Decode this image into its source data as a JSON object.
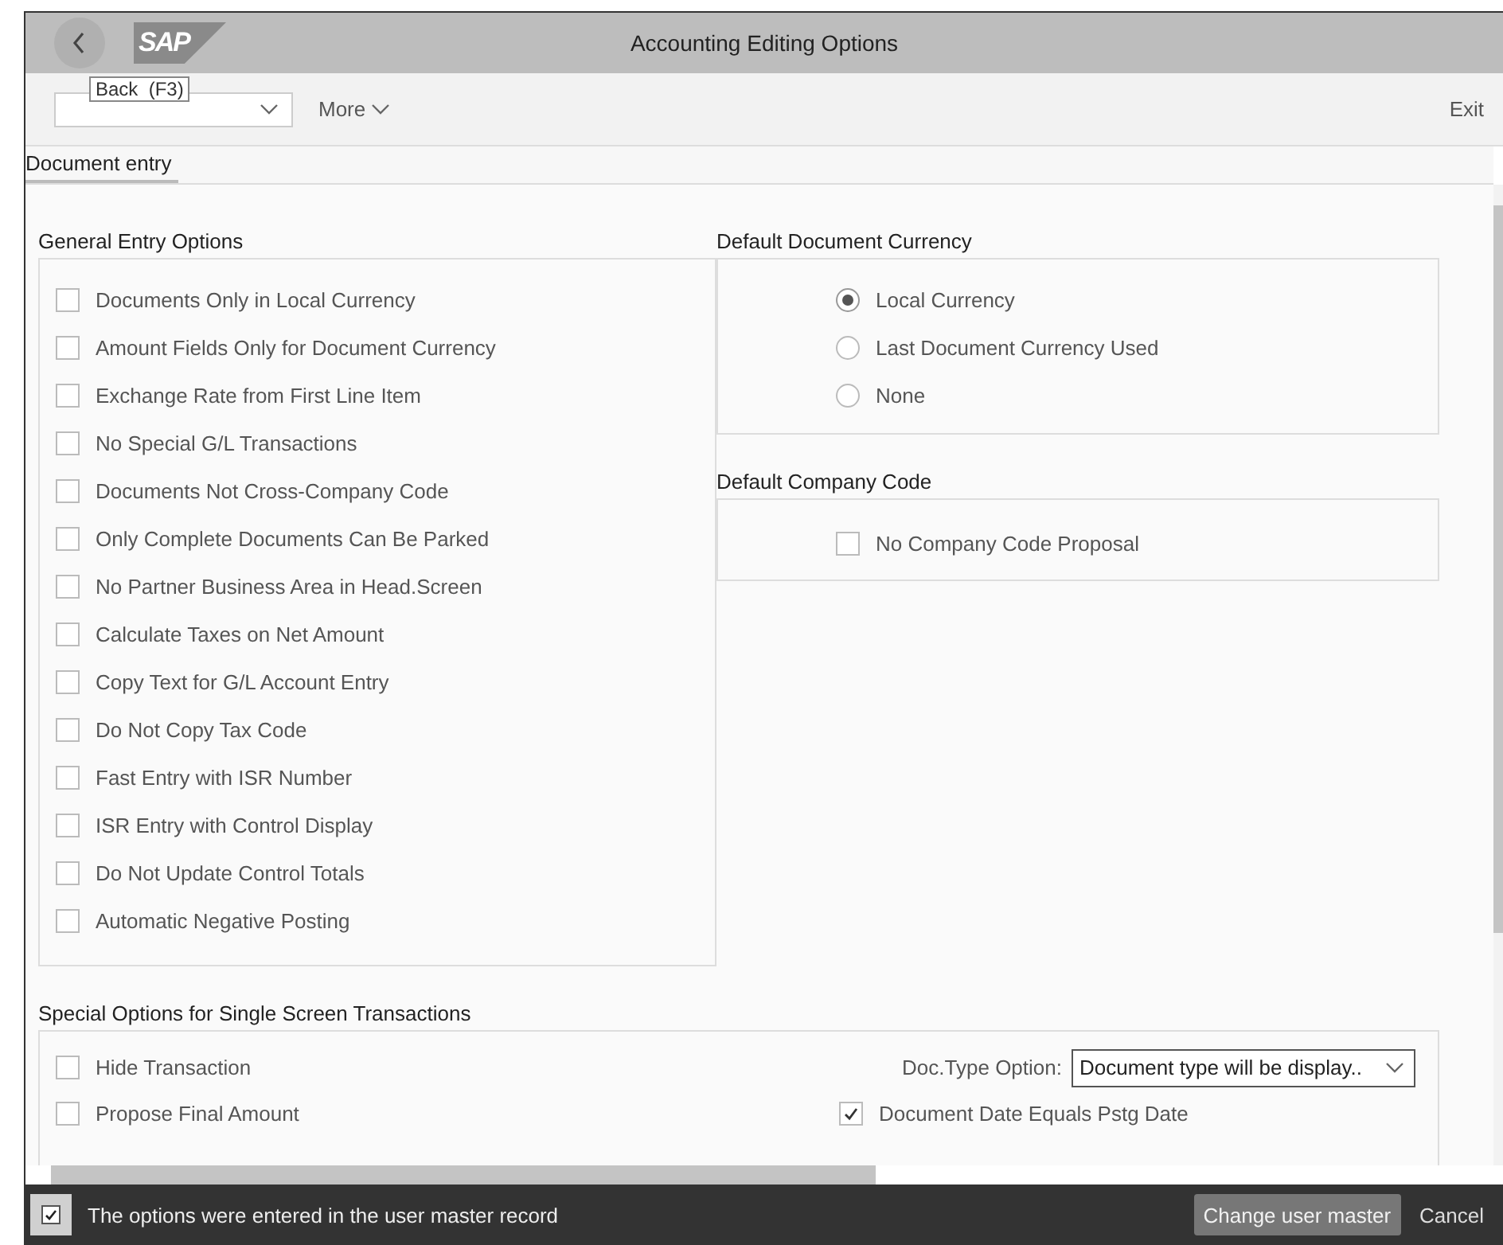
{
  "window": {
    "title": "Accounting Editing Options",
    "logo": "SAP",
    "back_tooltip": "Back  (F3)"
  },
  "toolbar": {
    "more": "More",
    "exit": "Exit"
  },
  "tabs": [
    {
      "label": "Document entry",
      "selected": true
    }
  ],
  "general_entry_options": {
    "title": "General Entry Options",
    "options": [
      {
        "label": "Documents Only in Local Currency",
        "checked": false
      },
      {
        "label": "Amount Fields Only for Document Currency",
        "checked": false
      },
      {
        "label": "Exchange Rate from First Line Item",
        "checked": false
      },
      {
        "label": "No Special G/L Transactions",
        "checked": false
      },
      {
        "label": "Documents Not Cross-Company Code",
        "checked": false
      },
      {
        "label": "Only Complete Documents Can Be Parked",
        "checked": false
      },
      {
        "label": "No Partner Business Area in Head.Screen",
        "checked": false
      },
      {
        "label": "Calculate Taxes on Net Amount",
        "checked": false
      },
      {
        "label": "Copy Text for G/L Account Entry",
        "checked": false
      },
      {
        "label": "Do Not Copy Tax Code",
        "checked": false
      },
      {
        "label": "Fast Entry with ISR Number",
        "checked": false
      },
      {
        "label": "ISR Entry with Control Display",
        "checked": false
      },
      {
        "label": "Do Not Update Control Totals",
        "checked": false
      },
      {
        "label": "Automatic Negative Posting",
        "checked": false
      }
    ]
  },
  "default_document_currency": {
    "title": "Default Document Currency",
    "options": [
      {
        "label": "Local Currency",
        "selected": true
      },
      {
        "label": "Last Document Currency Used",
        "selected": false
      },
      {
        "label": "None",
        "selected": false
      }
    ]
  },
  "default_company_code": {
    "title": "Default Company Code",
    "options": [
      {
        "label": "No Company Code Proposal",
        "checked": false
      }
    ]
  },
  "special_options": {
    "title": "Special Options for Single Screen Transactions",
    "options": [
      {
        "label": "Hide Transaction",
        "checked": false
      },
      {
        "label": "Propose Final Amount",
        "checked": false
      }
    ],
    "doc_type_option": {
      "label": "Doc.Type Option:",
      "value": "Document type will be display.."
    },
    "right_options": [
      {
        "label": "Document Date Equals Pstg Date",
        "checked": true
      }
    ]
  },
  "status_bar": {
    "message": "The options were entered in the user master record",
    "buttons": [
      "Change user master",
      "Cancel"
    ]
  }
}
